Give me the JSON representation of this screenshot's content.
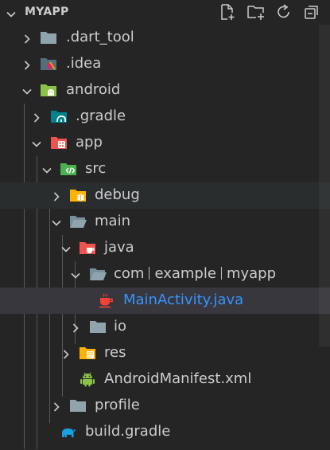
{
  "explorer": {
    "title": "MYAPP",
    "actions": [
      {
        "name": "new-file-icon"
      },
      {
        "name": "new-folder-icon"
      },
      {
        "name": "refresh-icon"
      },
      {
        "name": "collapse-all-icon"
      }
    ]
  },
  "tree": [
    {
      "label": ".dart_tool",
      "icon": "folder-icon",
      "expanded": false
    },
    {
      "label": ".idea",
      "icon": "idea-folder-icon",
      "expanded": false
    },
    {
      "label": "android",
      "icon": "android-folder-icon",
      "expanded": true
    },
    {
      "label": ".gradle",
      "icon": "gradle-folder-icon",
      "expanded": false
    },
    {
      "label": "app",
      "icon": "app-folder-icon",
      "expanded": true
    },
    {
      "label": "src",
      "icon": "src-folder-icon",
      "expanded": true
    },
    {
      "label": "debug",
      "icon": "debug-folder-icon",
      "expanded": false
    },
    {
      "label": "main",
      "icon": "folder-open-icon",
      "expanded": true
    },
    {
      "label": "java",
      "icon": "java-folder-icon",
      "expanded": true
    },
    {
      "label_parts": [
        "com",
        "example",
        "myapp"
      ],
      "icon": "folder-open-icon",
      "expanded": true
    },
    {
      "label": "MainActivity.java",
      "icon": "java-file-icon",
      "selected": true
    },
    {
      "label": "io",
      "icon": "folder-icon",
      "expanded": false
    },
    {
      "label": "res",
      "icon": "res-folder-icon",
      "expanded": false
    },
    {
      "label": "AndroidManifest.xml",
      "icon": "android-manifest-icon"
    },
    {
      "label": "profile",
      "icon": "folder-icon",
      "expanded": false
    },
    {
      "label": "build.gradle",
      "icon": "gradle-file-icon"
    }
  ],
  "colors": {
    "background": "#252526",
    "selected_row": "#37373d",
    "selected_text": "#3794ff",
    "text": "#cccccc"
  }
}
